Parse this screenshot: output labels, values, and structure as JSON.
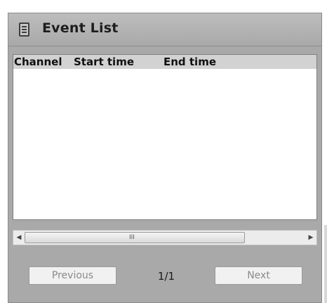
{
  "panel": {
    "title": "Event List"
  },
  "list": {
    "columns": [
      "Channel",
      "Start time",
      "End time"
    ],
    "rows": []
  },
  "scrollbar": {
    "left_arrow": "◀",
    "right_arrow": "▶",
    "grip": "III"
  },
  "pagination": {
    "previous_label": "Previous",
    "page_text": "1/1",
    "next_label": "Next"
  }
}
